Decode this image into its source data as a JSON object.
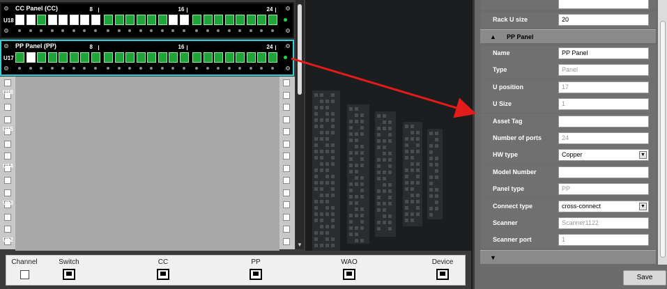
{
  "rack": {
    "cc_panel": {
      "title": "CC Panel (CC)",
      "u": "U18",
      "numbers": [
        "8",
        "16",
        "24"
      ],
      "ports_on": [
        false,
        false,
        true,
        false,
        false,
        false,
        false,
        false,
        true,
        true,
        true,
        true,
        true,
        true,
        false,
        false,
        true,
        true,
        true,
        true,
        true,
        true,
        true,
        true
      ]
    },
    "pp_panel": {
      "title": "PP Panel (PP)",
      "u": "U17",
      "numbers": [
        "8",
        "16",
        "24"
      ],
      "ports_on": [
        true,
        false,
        true,
        true,
        true,
        true,
        true,
        true,
        true,
        true,
        true,
        true,
        true,
        true,
        true,
        true,
        true,
        true,
        true,
        true,
        true,
        true,
        true,
        true
      ]
    },
    "u_labels": [
      "U16",
      "U15",
      "U14",
      "U13",
      "U12"
    ]
  },
  "legend": {
    "channel": "Channel",
    "switch": "Switch",
    "cc": "CC",
    "pp": "PP",
    "wao": "WAO",
    "device": "Device"
  },
  "props": {
    "rack_u_size_label": "Rack U size",
    "rack_u_size_value": "20",
    "section_title": "PP Panel",
    "rows": [
      {
        "label": "Name",
        "value": "PP Panel",
        "ro": false,
        "dropdown": false
      },
      {
        "label": "Type",
        "value": "Panel",
        "ro": true,
        "dropdown": false
      },
      {
        "label": "U position",
        "value": "17",
        "ro": true,
        "dropdown": false
      },
      {
        "label": "U Size",
        "value": "1",
        "ro": true,
        "dropdown": false
      },
      {
        "label": "Asset Tag",
        "value": "",
        "ro": false,
        "dropdown": false
      },
      {
        "label": "Number of ports",
        "value": "24",
        "ro": true,
        "dropdown": false
      },
      {
        "label": "HW type",
        "value": "Copper",
        "ro": false,
        "dropdown": true
      },
      {
        "label": "Model Number",
        "value": "",
        "ro": false,
        "dropdown": false
      },
      {
        "label": "Panel type",
        "value": "PP",
        "ro": true,
        "dropdown": false
      },
      {
        "label": "Connect type",
        "value": "cross-connect",
        "ro": false,
        "dropdown": true
      },
      {
        "label": "Scanner",
        "value": "Scanner1122",
        "ro": true,
        "dropdown": false
      },
      {
        "label": "Scanner port",
        "value": "1",
        "ro": true,
        "dropdown": false
      }
    ],
    "save_label": "Save"
  },
  "colors": {
    "port_on": "#1fa53a",
    "selection": "#2fd0d6",
    "arrow": "#e41b1b"
  }
}
